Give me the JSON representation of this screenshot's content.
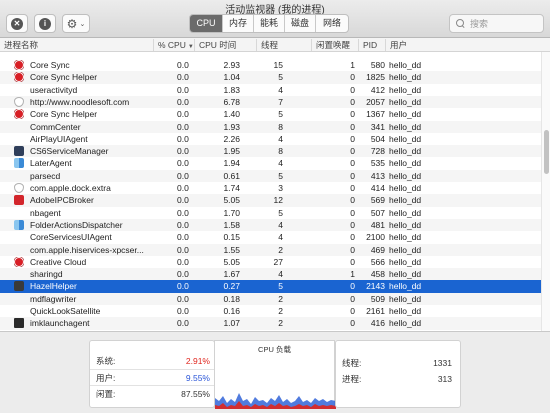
{
  "window": {
    "title": "活动监视器 (我的进程)"
  },
  "toolbar": {
    "close_glyph": "✕",
    "info_glyph": "i",
    "gear_glyph": "⚙",
    "chevron_glyph": "⌄",
    "tabs": [
      {
        "label": "CPU",
        "active": true
      },
      {
        "label": "内存",
        "active": false
      },
      {
        "label": "能耗",
        "active": false
      },
      {
        "label": "磁盘",
        "active": false
      },
      {
        "label": "网络",
        "active": false
      }
    ],
    "search_placeholder": "搜索"
  },
  "columns": {
    "name": "进程名称",
    "cpu": "% CPU",
    "sort_glyph": "▼",
    "cpu_time": "CPU 时间",
    "threads": "线程",
    "idle_wake": "闲置唤醒",
    "pid": "PID",
    "user": "用户"
  },
  "processes": [
    {
      "icon": "creative-cloud",
      "name": "Core Sync",
      "cpu": "0.0",
      "time": "2.93",
      "threads": "15",
      "wake": "1",
      "pid": "580",
      "user": "hello_dd"
    },
    {
      "icon": "creative-cloud",
      "name": "Core Sync Helper",
      "cpu": "0.0",
      "time": "1.04",
      "threads": "5",
      "wake": "0",
      "pid": "1825",
      "user": "hello_dd"
    },
    {
      "icon": "",
      "name": "useractivityd",
      "cpu": "0.0",
      "time": "1.83",
      "threads": "4",
      "wake": "0",
      "pid": "412",
      "user": "hello_dd"
    },
    {
      "icon": "shield",
      "name": "http://www.noodlesoft.com",
      "cpu": "0.0",
      "time": "6.78",
      "threads": "7",
      "wake": "0",
      "pid": "2057",
      "user": "hello_dd"
    },
    {
      "icon": "creative-cloud",
      "name": "Core Sync Helper",
      "cpu": "0.0",
      "time": "1.40",
      "threads": "5",
      "wake": "0",
      "pid": "1367",
      "user": "hello_dd"
    },
    {
      "icon": "",
      "name": "CommCenter",
      "cpu": "0.0",
      "time": "1.93",
      "threads": "8",
      "wake": "0",
      "pid": "341",
      "user": "hello_dd"
    },
    {
      "icon": "",
      "name": "AirPlayUIAgent",
      "cpu": "0.0",
      "time": "2.26",
      "threads": "4",
      "wake": "0",
      "pid": "504",
      "user": "hello_dd"
    },
    {
      "icon": "cs6",
      "name": "CS6ServiceManager",
      "cpu": "0.0",
      "time": "1.95",
      "threads": "8",
      "wake": "0",
      "pid": "728",
      "user": "hello_dd"
    },
    {
      "icon": "finder",
      "name": "LaterAgent",
      "cpu": "0.0",
      "time": "1.94",
      "threads": "4",
      "wake": "0",
      "pid": "535",
      "user": "hello_dd"
    },
    {
      "icon": "",
      "name": "parsecd",
      "cpu": "0.0",
      "time": "0.61",
      "threads": "5",
      "wake": "0",
      "pid": "413",
      "user": "hello_dd"
    },
    {
      "icon": "shield",
      "name": "com.apple.dock.extra",
      "cpu": "0.0",
      "time": "1.74",
      "threads": "3",
      "wake": "0",
      "pid": "414",
      "user": "hello_dd"
    },
    {
      "icon": "adobe",
      "name": "AdobeIPCBroker",
      "cpu": "0.0",
      "time": "5.05",
      "threads": "12",
      "wake": "0",
      "pid": "569",
      "user": "hello_dd"
    },
    {
      "icon": "",
      "name": "nbagent",
      "cpu": "0.0",
      "time": "1.70",
      "threads": "5",
      "wake": "0",
      "pid": "507",
      "user": "hello_dd"
    },
    {
      "icon": "finder",
      "name": "FolderActionsDispatcher",
      "cpu": "0.0",
      "time": "1.58",
      "threads": "4",
      "wake": "0",
      "pid": "481",
      "user": "hello_dd"
    },
    {
      "icon": "",
      "name": "CoreServicesUIAgent",
      "cpu": "0.0",
      "time": "0.15",
      "threads": "4",
      "wake": "0",
      "pid": "2100",
      "user": "hello_dd"
    },
    {
      "icon": "",
      "name": "com.apple.hiservices-xpcser...",
      "cpu": "0.0",
      "time": "1.55",
      "threads": "2",
      "wake": "0",
      "pid": "469",
      "user": "hello_dd"
    },
    {
      "icon": "creative-cloud",
      "name": "Creative Cloud",
      "cpu": "0.0",
      "time": "5.05",
      "threads": "27",
      "wake": "0",
      "pid": "566",
      "user": "hello_dd"
    },
    {
      "icon": "",
      "name": "sharingd",
      "cpu": "0.0",
      "time": "1.67",
      "threads": "4",
      "wake": "1",
      "pid": "458",
      "user": "hello_dd"
    },
    {
      "icon": "hazel",
      "name": "HazelHelper",
      "cpu": "0.0",
      "time": "0.27",
      "threads": "5",
      "wake": "0",
      "pid": "2143",
      "user": "hello_dd",
      "selected": true
    },
    {
      "icon": "",
      "name": "mdflagwriter",
      "cpu": "0.0",
      "time": "0.18",
      "threads": "2",
      "wake": "0",
      "pid": "509",
      "user": "hello_dd"
    },
    {
      "icon": "",
      "name": "QuickLookSatellite",
      "cpu": "0.0",
      "time": "0.16",
      "threads": "2",
      "wake": "0",
      "pid": "2161",
      "user": "hello_dd"
    },
    {
      "icon": "terminal",
      "name": "imklaunchagent",
      "cpu": "0.0",
      "time": "1.07",
      "threads": "2",
      "wake": "0",
      "pid": "416",
      "user": "hello_dd"
    }
  ],
  "stats": {
    "system_label": "系统:",
    "system_value": "2.91%",
    "user_label": "用户:",
    "user_value": "9.55%",
    "idle_label": "闲置:",
    "idle_value": "87.55%"
  },
  "chart": {
    "title": "CPU 负载",
    "colors": {
      "user": "#3164d8",
      "system": "#e0261e"
    }
  },
  "counts": {
    "threads_label": "线程:",
    "threads_value": "1331",
    "processes_label": "进程:",
    "processes_value": "313"
  }
}
